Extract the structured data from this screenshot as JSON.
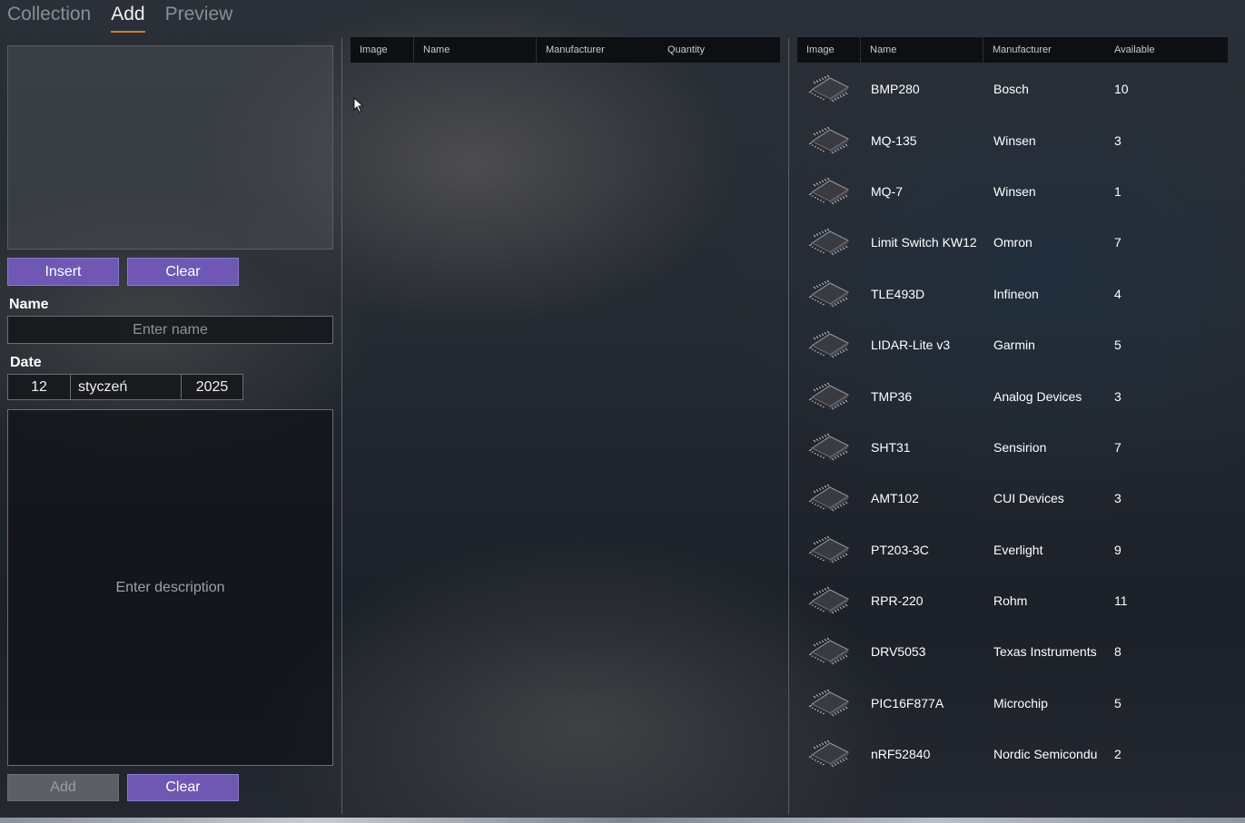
{
  "tabs": [
    {
      "label": "Collection",
      "active": false
    },
    {
      "label": "Add",
      "active": true
    },
    {
      "label": "Preview",
      "active": false
    }
  ],
  "form": {
    "insert_label": "Insert",
    "clear_image_label": "Clear",
    "name_label": "Name",
    "name_placeholder": "Enter name",
    "date_label": "Date",
    "date": {
      "day": "12",
      "month": "styczeń",
      "year": "2025"
    },
    "description_placeholder": "Enter description",
    "add_label": "Add",
    "clear_form_label": "Clear"
  },
  "middle_table": {
    "headers": {
      "image": "Image",
      "name": "Name",
      "manufacturer": "Manufacturer",
      "quantity": "Quantity"
    },
    "rows": []
  },
  "right_table": {
    "headers": {
      "image": "Image",
      "name": "Name",
      "manufacturer": "Manufacturer",
      "available": "Available"
    },
    "rows": [
      {
        "name": "BMP280",
        "manufacturer": "Bosch",
        "available": "10"
      },
      {
        "name": "MQ-135",
        "manufacturer": "Winsen",
        "available": "3"
      },
      {
        "name": "MQ-7",
        "manufacturer": "Winsen",
        "available": "1"
      },
      {
        "name": "Limit Switch KW12",
        "manufacturer": "Omron",
        "available": "7"
      },
      {
        "name": "TLE493D",
        "manufacturer": "Infineon",
        "available": "4"
      },
      {
        "name": "LIDAR-Lite v3",
        "manufacturer": "Garmin",
        "available": "5"
      },
      {
        "name": "TMP36",
        "manufacturer": "Analog Devices",
        "available": "3"
      },
      {
        "name": "SHT31",
        "manufacturer": "Sensirion",
        "available": "7"
      },
      {
        "name": "AMT102",
        "manufacturer": "CUI Devices",
        "available": "3"
      },
      {
        "name": "PT203-3C",
        "manufacturer": "Everlight",
        "available": "9"
      },
      {
        "name": "RPR-220",
        "manufacturer": "Rohm",
        "available": "11"
      },
      {
        "name": "DRV5053",
        "manufacturer": "Texas Instruments",
        "available": "8"
      },
      {
        "name": "PIC16F877A",
        "manufacturer": "Microchip",
        "available": "5"
      },
      {
        "name": "nRF52840",
        "manufacturer": "Nordic Semicondu",
        "available": "2"
      }
    ],
    "row_icon": "chip-icon"
  },
  "colors": {
    "accent": "#6e58b4",
    "tab_underline": "#d77c2b",
    "header_bg": "#0d0f13"
  }
}
